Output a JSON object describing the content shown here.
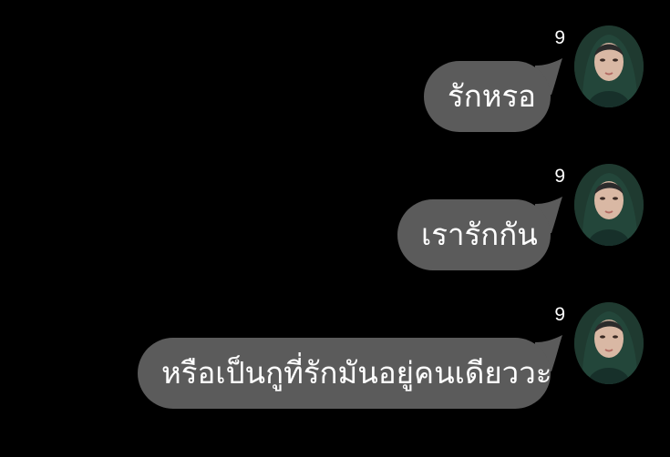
{
  "messages": [
    {
      "text": "รักหรอ",
      "count": "9",
      "avatar_icon": "user-avatar"
    },
    {
      "text": "เรารักกัน",
      "count": "9",
      "avatar_icon": "user-avatar"
    },
    {
      "text": "หรือเป็นกูที่รักมันอยู่คนเดียววะ",
      "count": "9",
      "avatar_icon": "user-avatar"
    }
  ],
  "colors": {
    "background": "#000000",
    "bubble": "#5b5b5b",
    "text": "#ffffff"
  }
}
